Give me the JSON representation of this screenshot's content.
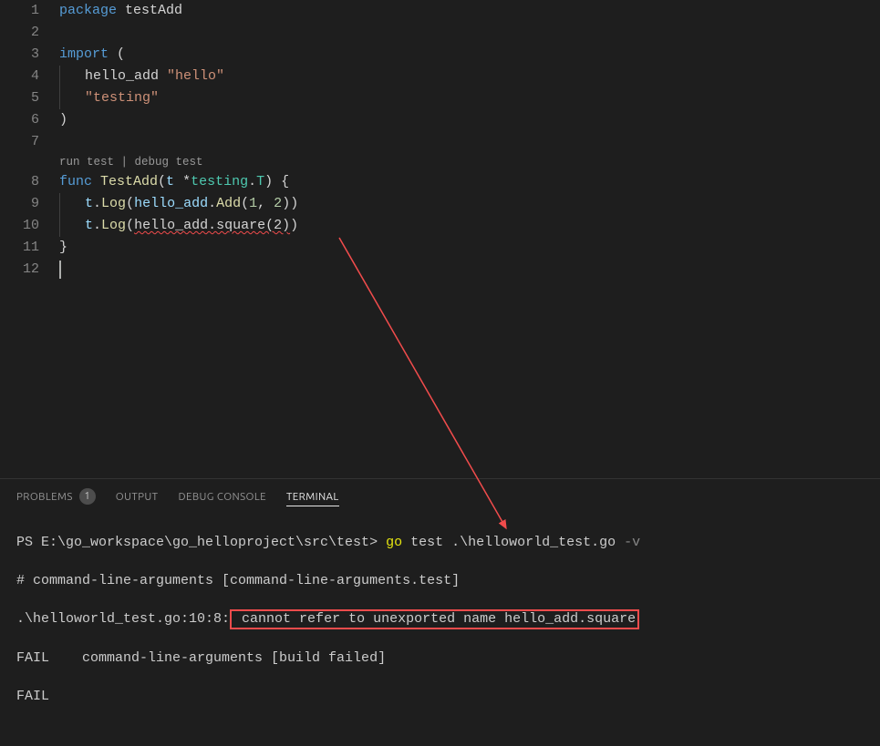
{
  "gutter": {
    "lines": [
      "1",
      "2",
      "3",
      "4",
      "5",
      "6",
      "7",
      "8",
      "9",
      "10",
      "11",
      "12"
    ]
  },
  "code": {
    "l1_kw": "package",
    "l1_name": " testAdd",
    "l3_kw": "import",
    "l3_paren": " (",
    "l4_alias": "hello_add",
    "l4_str": " \"hello\"",
    "l5_str": "\"testing\"",
    "l6_paren": ")",
    "codelens_run": "run test",
    "codelens_sep": " | ",
    "codelens_debug": "debug test",
    "l8_kw": "func",
    "l8_fn": " TestAdd",
    "l8_sig1": "(",
    "l8_param": "t",
    "l8_sig2": " *",
    "l8_type1": "testing",
    "l8_dot": ".",
    "l8_type2": "T",
    "l8_sig3": ") {",
    "l9_t": "t",
    "l9_dot": ".",
    "l9_log": "Log",
    "l9_p1": "(",
    "l9_mod": "hello_add",
    "l9_dot2": ".",
    "l9_add": "Add",
    "l9_p2": "(",
    "l9_n1": "1",
    "l9_c": ", ",
    "l9_n2": "2",
    "l9_p3": "))",
    "l10_t": "t",
    "l10_dot": ".",
    "l10_log": "Log",
    "l10_p1": "(",
    "l10_err": "hello_add.square(2)",
    "l10_p2": ")",
    "l11": "}"
  },
  "tabs": {
    "problems": "PROBLEMS",
    "problems_count": "1",
    "output": "OUTPUT",
    "debug": "DEBUG CONSOLE",
    "terminal": "TERMINAL"
  },
  "terminal": {
    "prompt_prefix": "PS E:\\go_workspace\\go_helloproject\\src\\test> ",
    "cmd_bin": "go",
    "cmd_args1": " test",
    "cmd_args2": " .\\helloworld_test.go",
    "cmd_flag": " -v",
    "line2": "# command-line-arguments [command-line-arguments.test]",
    "line3_loc": ".\\helloworld_test.go:10:8:",
    "line3_msg": " cannot refer to unexported name hello_add.square",
    "line4": "FAIL    command-line-arguments [build failed]",
    "line5": "FAIL"
  }
}
